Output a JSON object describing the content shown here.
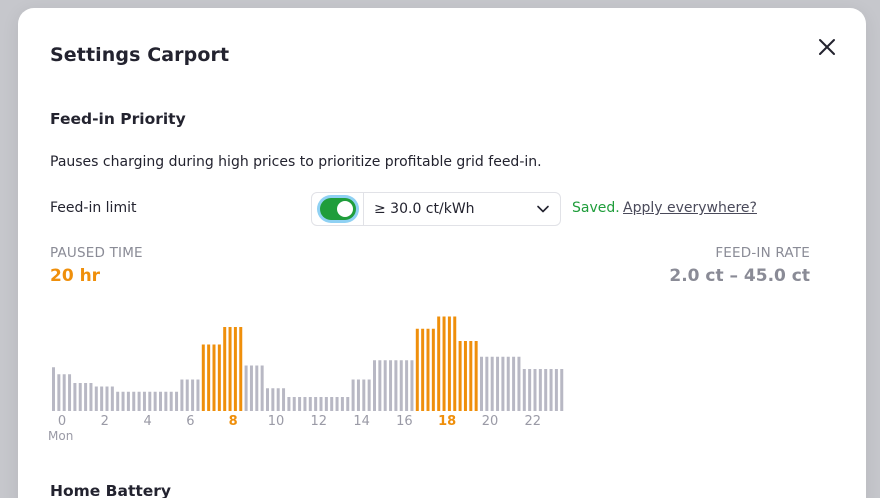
{
  "modal": {
    "title": "Settings Carport",
    "close_icon": "close-icon"
  },
  "feed_in": {
    "section_title": "Feed-in Priority",
    "description": "Pauses charging during high prices to prioritize profitable grid feed-in.",
    "limit_label": "Feed-in limit",
    "toggle_on": true,
    "select_value": "≥ 30.0 ct/kWh",
    "saved_text": "Saved.",
    "apply_link": "Apply everywhere?"
  },
  "stats": {
    "paused_label": "PAUSED TIME",
    "paused_value": "20 hr",
    "rate_label": "FEED-IN RATE",
    "rate_value": "2.0 ct – 45.0 ct"
  },
  "colors": {
    "accent_orange": "#ef8f0b",
    "bar_grey": "#b8b8c4",
    "toggle_green": "#1f9d3b"
  },
  "chart_data": {
    "type": "bar",
    "x_ticks": [
      "0",
      "2",
      "4",
      "6",
      "8",
      "10",
      "12",
      "14",
      "16",
      "18",
      "20",
      "22"
    ],
    "highlighted_ticks": [
      "8",
      "18"
    ],
    "day_label": "Mon",
    "bars_per_hour": 4,
    "values": [
      25,
      21,
      21,
      21,
      16,
      16,
      16,
      16,
      14,
      14,
      14,
      14,
      11,
      11,
      11,
      11,
      11,
      11,
      11,
      11,
      11,
      11,
      11,
      11,
      18,
      18,
      18,
      18,
      38,
      38,
      38,
      38,
      48,
      48,
      48,
      48,
      26,
      26,
      26,
      26,
      13,
      13,
      13,
      13,
      8,
      8,
      8,
      8,
      8,
      8,
      8,
      8,
      8,
      8,
      8,
      8,
      18,
      18,
      18,
      18,
      29,
      29,
      29,
      29,
      29,
      29,
      29,
      29,
      47,
      47,
      47,
      47,
      54,
      54,
      54,
      54,
      40,
      40,
      40,
      40,
      31,
      31,
      31,
      31,
      31,
      31,
      31,
      31,
      24,
      24,
      24,
      24,
      24,
      24,
      24,
      24
    ],
    "paused": [
      false,
      false,
      false,
      false,
      false,
      false,
      false,
      false,
      false,
      false,
      false,
      false,
      false,
      false,
      false,
      false,
      false,
      false,
      false,
      false,
      false,
      false,
      false,
      false,
      false,
      false,
      false,
      false,
      true,
      true,
      true,
      true,
      true,
      true,
      true,
      true,
      false,
      false,
      false,
      false,
      false,
      false,
      false,
      false,
      false,
      false,
      false,
      false,
      false,
      false,
      false,
      false,
      false,
      false,
      false,
      false,
      false,
      false,
      false,
      false,
      false,
      false,
      false,
      false,
      false,
      false,
      false,
      false,
      true,
      true,
      true,
      true,
      true,
      true,
      true,
      true,
      true,
      true,
      true,
      true,
      false,
      false,
      false,
      false,
      false,
      false,
      false,
      false,
      false,
      false,
      false,
      false,
      false,
      false,
      false,
      false
    ]
  },
  "home_battery": {
    "section_title": "Home Battery"
  }
}
